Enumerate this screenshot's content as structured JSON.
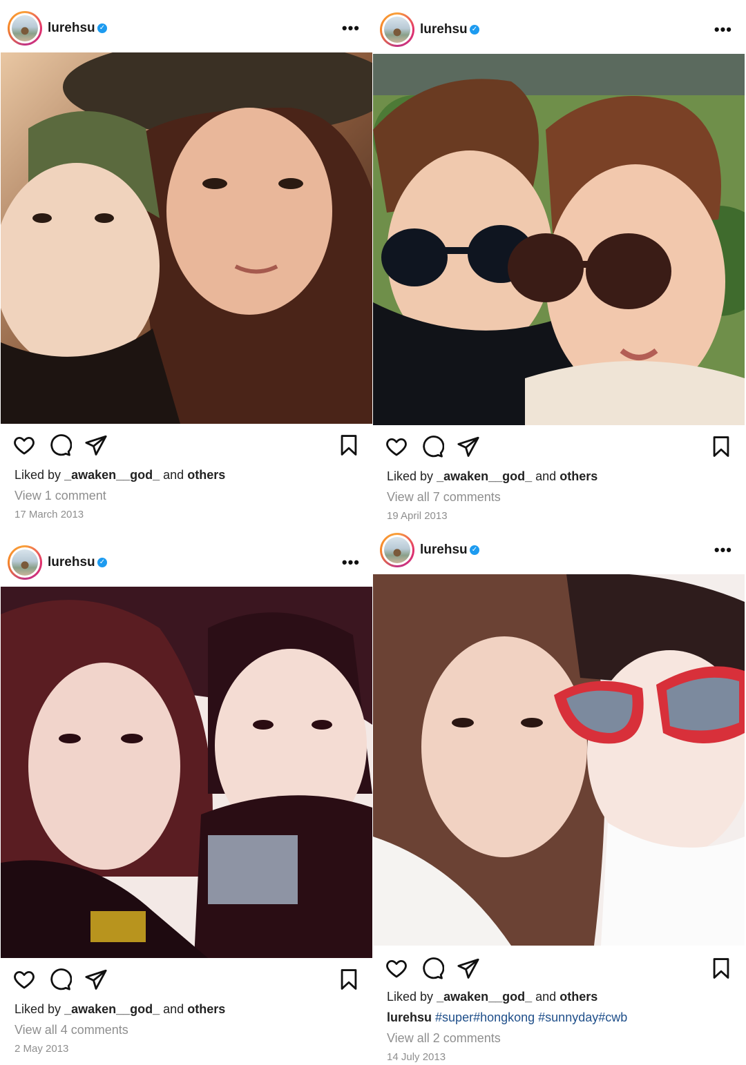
{
  "posts": [
    {
      "username": "lurehsu",
      "menu_label": "•••",
      "liked_prefix": "Liked by",
      "liked_user": "_awaken__god_",
      "liked_and": "and",
      "liked_others": "others",
      "comments_text": "View 1 comment",
      "date": "17 March 2013"
    },
    {
      "username": "lurehsu",
      "menu_label": "•••",
      "liked_prefix": "Liked by",
      "liked_user": "_awaken__god_",
      "liked_and": "and",
      "liked_others": "others",
      "comments_text": "View all 7 comments",
      "date": "19 April 2013"
    },
    {
      "username": "lurehsu",
      "menu_label": "•••",
      "liked_prefix": "Liked by",
      "liked_user": "_awaken__god_",
      "liked_and": "and",
      "liked_others": "others",
      "comments_text": "View all 4 comments",
      "date": "2 May 2013"
    },
    {
      "username": "lurehsu",
      "menu_label": "•••",
      "liked_prefix": "Liked by",
      "liked_user": "_awaken__god_",
      "liked_and": "and",
      "liked_others": "others",
      "caption_user": "lurehsu",
      "caption_tags": "#super#hongkong #sunnyday#cwb",
      "comments_text": "View all 2 comments",
      "date": "14 July 2013"
    }
  ],
  "colors": {
    "verified": "#1d9bf0",
    "hashtag": "#1f4f8a",
    "muted": "#8e8e8e"
  },
  "icons": [
    "heart-icon",
    "comment-icon",
    "share-icon",
    "bookmark-icon",
    "verified-badge-icon",
    "more-options-icon"
  ]
}
